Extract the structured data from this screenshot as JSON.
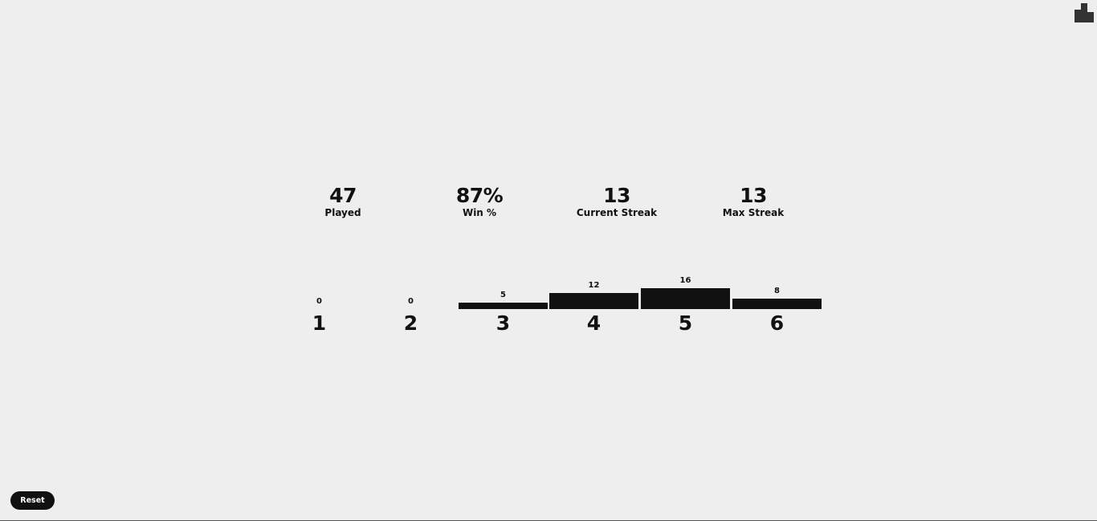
{
  "header": {
    "stats_icon": "bar-chart-icon"
  },
  "stats": [
    {
      "value": "47",
      "label": "Played"
    },
    {
      "value": "87%",
      "label": "Win %"
    },
    {
      "value": "13",
      "label": "Current Streak"
    },
    {
      "value": "13",
      "label": "Max Streak"
    }
  ],
  "distribution": [
    {
      "guess": "1",
      "count": 0
    },
    {
      "guess": "2",
      "count": 0
    },
    {
      "guess": "3",
      "count": 5
    },
    {
      "guess": "4",
      "count": 12
    },
    {
      "guess": "5",
      "count": 16
    },
    {
      "guess": "6",
      "count": 8
    }
  ],
  "footer": {
    "reset_label": "Reset"
  },
  "colors": {
    "background": "#eeeeee",
    "ink": "#111111",
    "button_text": "#ffffff"
  }
}
